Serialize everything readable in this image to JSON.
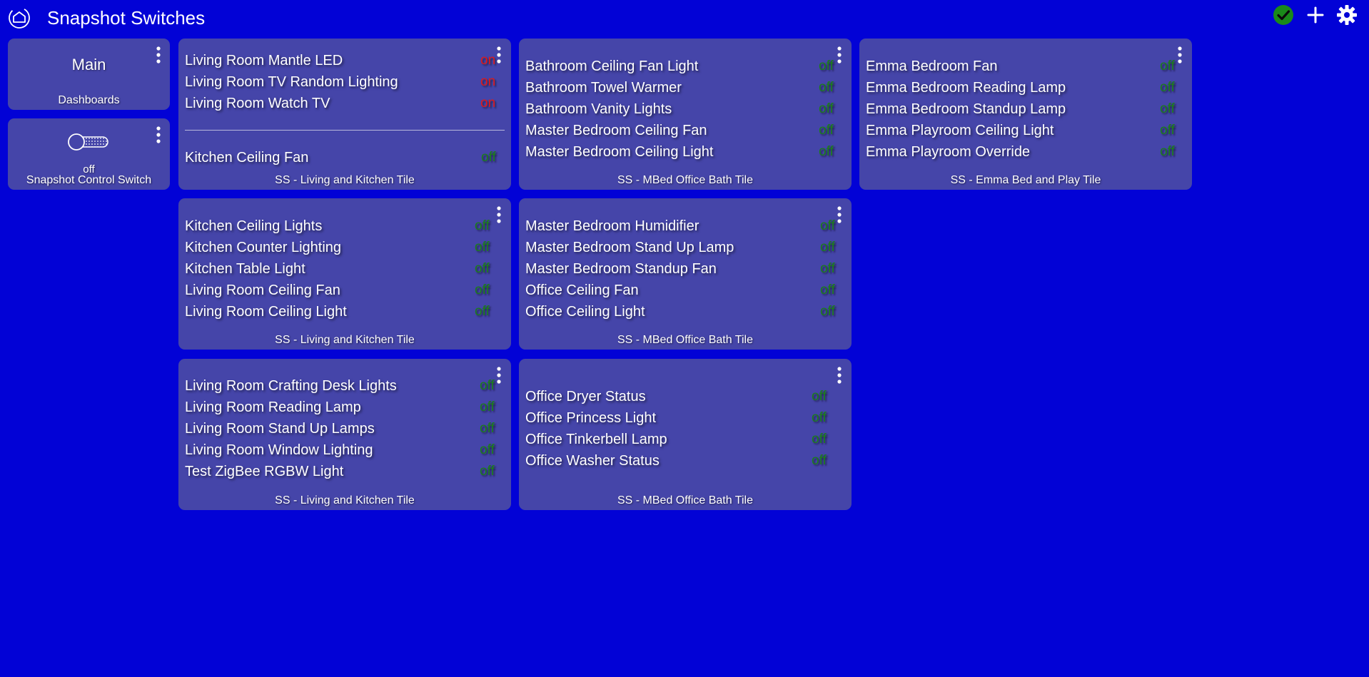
{
  "header": {
    "title": "Snapshot Switches"
  },
  "colors": {
    "background": "#0202d6",
    "tile": "#4545a9",
    "state_on": "#e01a1a",
    "state_off": "#1b7d1b",
    "status_ok": "#1a8a1a"
  },
  "main_tile": {
    "label": "Main",
    "title": "Dashboards"
  },
  "control_tile": {
    "state": "off",
    "title": "Snapshot Control Switch"
  },
  "tiles": [
    {
      "title": "SS - Living and Kitchen Tile",
      "items": [
        {
          "name": "Living Room Mantle LED",
          "state": "on"
        },
        {
          "name": "Living Room TV Random Lighting",
          "state": "on"
        },
        {
          "name": "Living Room Watch TV",
          "state": "on"
        }
      ],
      "items2": [
        {
          "name": "Kitchen Ceiling Fan",
          "state": "off"
        }
      ]
    },
    {
      "title": "SS - MBed Office Bath Tile",
      "items": [
        {
          "name": "Bathroom Ceiling Fan Light",
          "state": "off"
        },
        {
          "name": "Bathroom Towel Warmer",
          "state": "off"
        },
        {
          "name": "Bathroom Vanity Lights",
          "state": "off"
        },
        {
          "name": "Master Bedroom Ceiling Fan",
          "state": "off"
        },
        {
          "name": "Master Bedroom Ceiling Light",
          "state": "off"
        }
      ]
    },
    {
      "title": "SS - Emma Bed and Play Tile",
      "items": [
        {
          "name": "Emma Bedroom Fan",
          "state": "off"
        },
        {
          "name": "Emma Bedroom Reading Lamp",
          "state": "off"
        },
        {
          "name": "Emma Bedroom Standup Lamp",
          "state": "off"
        },
        {
          "name": "Emma Playroom Ceiling Light",
          "state": "off"
        },
        {
          "name": "Emma Playroom Override",
          "state": "off"
        }
      ]
    },
    {
      "title": "SS - Living and Kitchen Tile",
      "items": [
        {
          "name": "Kitchen Ceiling Lights",
          "state": "off"
        },
        {
          "name": "Kitchen Counter Lighting",
          "state": "off"
        },
        {
          "name": "Kitchen Table Light",
          "state": "off"
        },
        {
          "name": "Living Room Ceiling Fan",
          "state": "off"
        },
        {
          "name": "Living Room Ceiling Light",
          "state": "off"
        }
      ]
    },
    {
      "title": "SS - MBed Office Bath Tile",
      "items": [
        {
          "name": "Master Bedroom Humidifier",
          "state": "off"
        },
        {
          "name": "Master Bedroom Stand Up Lamp",
          "state": "off"
        },
        {
          "name": "Master Bedroom Standup Fan",
          "state": "off"
        },
        {
          "name": "Office Ceiling Fan",
          "state": "off"
        },
        {
          "name": "Office Ceiling Light",
          "state": "off"
        }
      ]
    },
    {
      "title": "SS - Living and Kitchen Tile",
      "items": [
        {
          "name": "Living Room Crafting Desk Lights",
          "state": "off"
        },
        {
          "name": "Living Room Reading Lamp",
          "state": "off"
        },
        {
          "name": "Living Room Stand Up Lamps",
          "state": "off"
        },
        {
          "name": "Living Room Window Lighting",
          "state": "off"
        },
        {
          "name": "Test ZigBee RGBW Light",
          "state": "off"
        }
      ]
    },
    {
      "title": "SS - MBed Office Bath Tile",
      "items": [
        {
          "name": "Office Dryer Status",
          "state": "off"
        },
        {
          "name": "Office Princess Light",
          "state": "off"
        },
        {
          "name": "Office Tinkerbell Lamp",
          "state": "off"
        },
        {
          "name": "Office Washer Status",
          "state": "off"
        }
      ]
    }
  ]
}
